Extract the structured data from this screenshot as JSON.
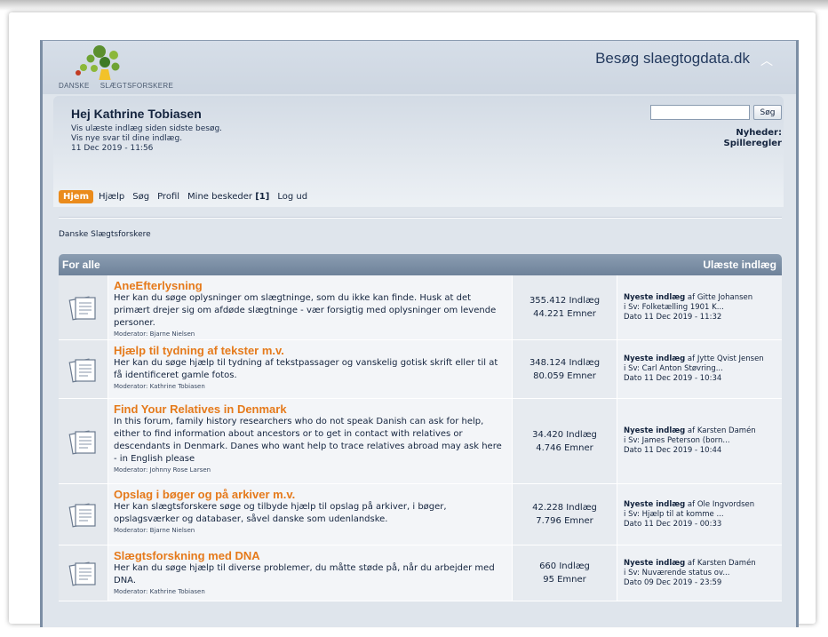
{
  "header": {
    "logo_left": "DANSKE",
    "logo_right": "SLÆGTSFORSKERE",
    "visit_link": "Besøg slaegtogdata.dk"
  },
  "user": {
    "greeting": "Hej Kathrine Tobiasen",
    "links": [
      "Vis ulæste indlæg siden sidste besøg.",
      "Vis nye svar til dine indlæg."
    ],
    "timestamp": "11 Dec 2019 - 11:56"
  },
  "search": {
    "placeholder": "",
    "button": "Søg"
  },
  "news": {
    "label": "Nyheder:",
    "link": "Spilleregler"
  },
  "nav": {
    "home": "Hjem",
    "help": "Hjælp",
    "search": "Søg",
    "profile": "Profil",
    "messages": "Mine beskeder",
    "messages_count": "[1]",
    "logout": "Log ud"
  },
  "breadcrumb": "Danske Slægtsforskere",
  "forum_header": {
    "left": "For alle",
    "right": "Ulæste indlæg"
  },
  "forums": [
    {
      "title": "AneEfterlysning",
      "description": "Her kan du søge oplysninger om slægtninge, som du ikke kan finde. Husk at det primært drejer sig om afdøde slægtninge - vær forsigtig med oplysninger om levende personer.",
      "moderator": "Moderator: Bjarne Nielsen",
      "posts": "355.412 Indlæg",
      "topics": "44.221 Emner",
      "last_label": "Nyeste indlæg",
      "last_by": " af Gitte Johansen",
      "last_subject": "i Sv: Folketælling 1901 K...",
      "last_date": "Dato 11 Dec 2019 - 11:32"
    },
    {
      "title": "Hjælp til tydning af tekster m.v.",
      "description": "Her kan du søge hjælp til tydning af tekstpassager og vanskelig gotisk skrift eller til at få identificeret gamle fotos.",
      "moderator": "Moderator: Kathrine Tobiasen",
      "posts": "348.124 Indlæg",
      "topics": "80.059 Emner",
      "last_label": "Nyeste indlæg",
      "last_by": " af Jytte Qvist Jensen",
      "last_subject": "i Sv: Carl Anton Støvring...",
      "last_date": "Dato 11 Dec 2019 - 10:34"
    },
    {
      "title": "Find Your Relatives in Denmark",
      "description": "In this forum, family history researchers who do not speak Danish can ask for help, either to find information about ancestors or to get in contact with relatives or descendants in Denmark. Danes who want help to trace relatives abroad may ask here - in English please",
      "moderator": "Moderator: Johnny Rose Larsen",
      "posts": "34.420 Indlæg",
      "topics": "4.746 Emner",
      "last_label": "Nyeste indlæg",
      "last_by": " af Karsten Damén",
      "last_subject": "i Sv: James Peterson (born...",
      "last_date": "Dato 11 Dec 2019 - 10:44"
    },
    {
      "title": "Opslag i bøger og på arkiver m.v.",
      "description": "Her kan slægtsforskere søge og tilbyde hjælp til opslag på arkiver, i bøger, opslagsværker og databaser, såvel danske som udenlandske.",
      "moderator": "Moderator: Bjarne Nielsen",
      "posts": "42.228 Indlæg",
      "topics": "7.796 Emner",
      "last_label": "Nyeste indlæg",
      "last_by": " af Ole Ingvordsen",
      "last_subject": "i Sv: Hjælp til at komme ...",
      "last_date": "Dato 11 Dec 2019 - 00:33"
    },
    {
      "title": "Slægtsforskning med DNA",
      "description": "Her kan du søge hjælp til diverse problemer, du måtte støde på, når du arbejder med DNA.",
      "moderator": "Moderator: Kathrine Tobiasen",
      "posts": "660 Indlæg",
      "topics": "95 Emner",
      "last_label": "Nyeste indlæg",
      "last_by": " af Karsten Damén",
      "last_subject": "i Sv: Nuværende status ov...",
      "last_date": "Dato 09 Dec 2019 - 23:59"
    }
  ]
}
